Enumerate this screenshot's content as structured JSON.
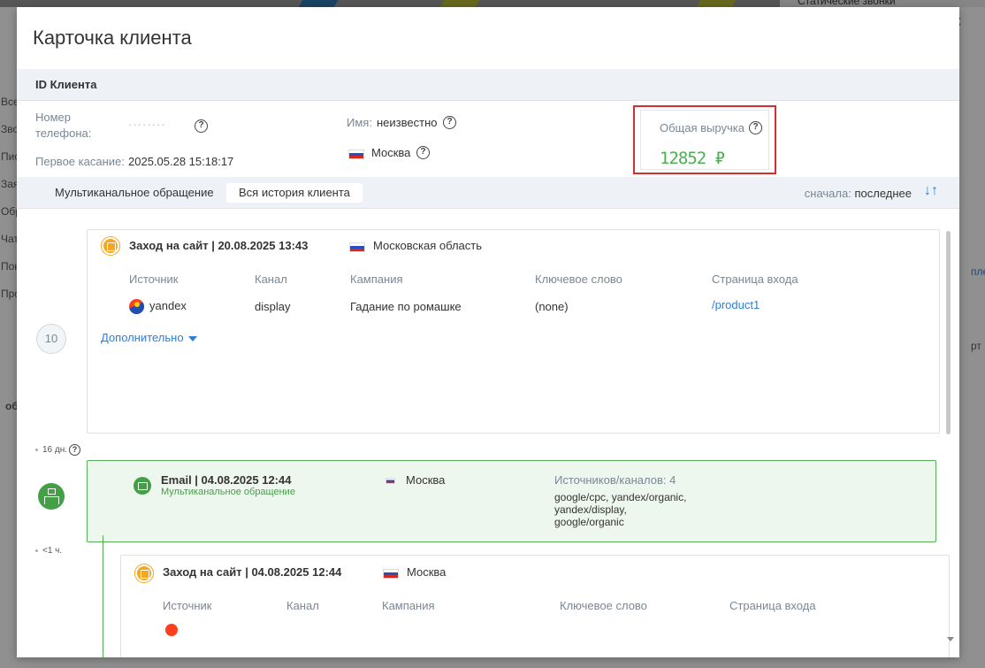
{
  "modal": {
    "title": "Карточка клиента",
    "close_label": "×"
  },
  "client": {
    "id_label": "ID Клиента",
    "phone_label_1": "Номер",
    "phone_label_2": "телефона:",
    "phone_value": "········",
    "first_touch_label": "Первое касание:",
    "first_touch_value": "2025.05.28 15:18:17",
    "name_label": "Имя:",
    "name_value": "неизвестно",
    "city_value": "Москва",
    "revenue_label": "Общая выручка",
    "revenue_value": "12852 ₽"
  },
  "tabs": [
    {
      "label": "Мультиканальное обращение",
      "active": false
    },
    {
      "label": "Вся история клиента",
      "active": true
    }
  ],
  "sort": {
    "label": "сначала:",
    "value": "последнее"
  },
  "timeline": {
    "count_badge": "10",
    "gap_1": "16 дн.",
    "gap_2": "<1 ч.",
    "event_1": {
      "title": "Заход на сайт | 20.08.2025 13:43",
      "region": "Московская область",
      "columns": [
        "Источник",
        "Канал",
        "Кампания",
        "Ключевое слово",
        "Страница входа"
      ],
      "source": "yandex",
      "channel": "display",
      "campaign": "Гадание по ромашке",
      "keyword": "(none)",
      "landing": "/product1",
      "more_label": "Дополнительно"
    },
    "event_2": {
      "title": "Email | 04.08.2025 12:44",
      "subtitle": "Мультиканальное обращение",
      "region": "Москва",
      "sources_label": "Источников/каналов: 4",
      "sources_line_1": "google/cpc, yandex/organic,",
      "sources_line_2": "yandex/display,",
      "sources_line_3": "google/organic"
    },
    "event_3": {
      "title": "Заход на сайт | 04.08.2025 12:44",
      "region": "Москва",
      "columns": [
        "Источник",
        "Канал",
        "Кампания",
        "Ключевое слово",
        "Страница входа"
      ]
    }
  },
  "background": {
    "left_items": [
      "Все",
      "Зво",
      "Пис",
      "Зая",
      "Обр",
      "Чат",
      "Пок",
      "Про"
    ],
    "top_right": "Статические звонки",
    "right_link": "пле",
    "right_text": "рт",
    "left_lower": "об"
  },
  "colors": {
    "accent_blue": "#2d7fd6",
    "success_green": "#4caf50",
    "highlight_red": "#d32f2f",
    "site_orange": "#f5a623"
  }
}
